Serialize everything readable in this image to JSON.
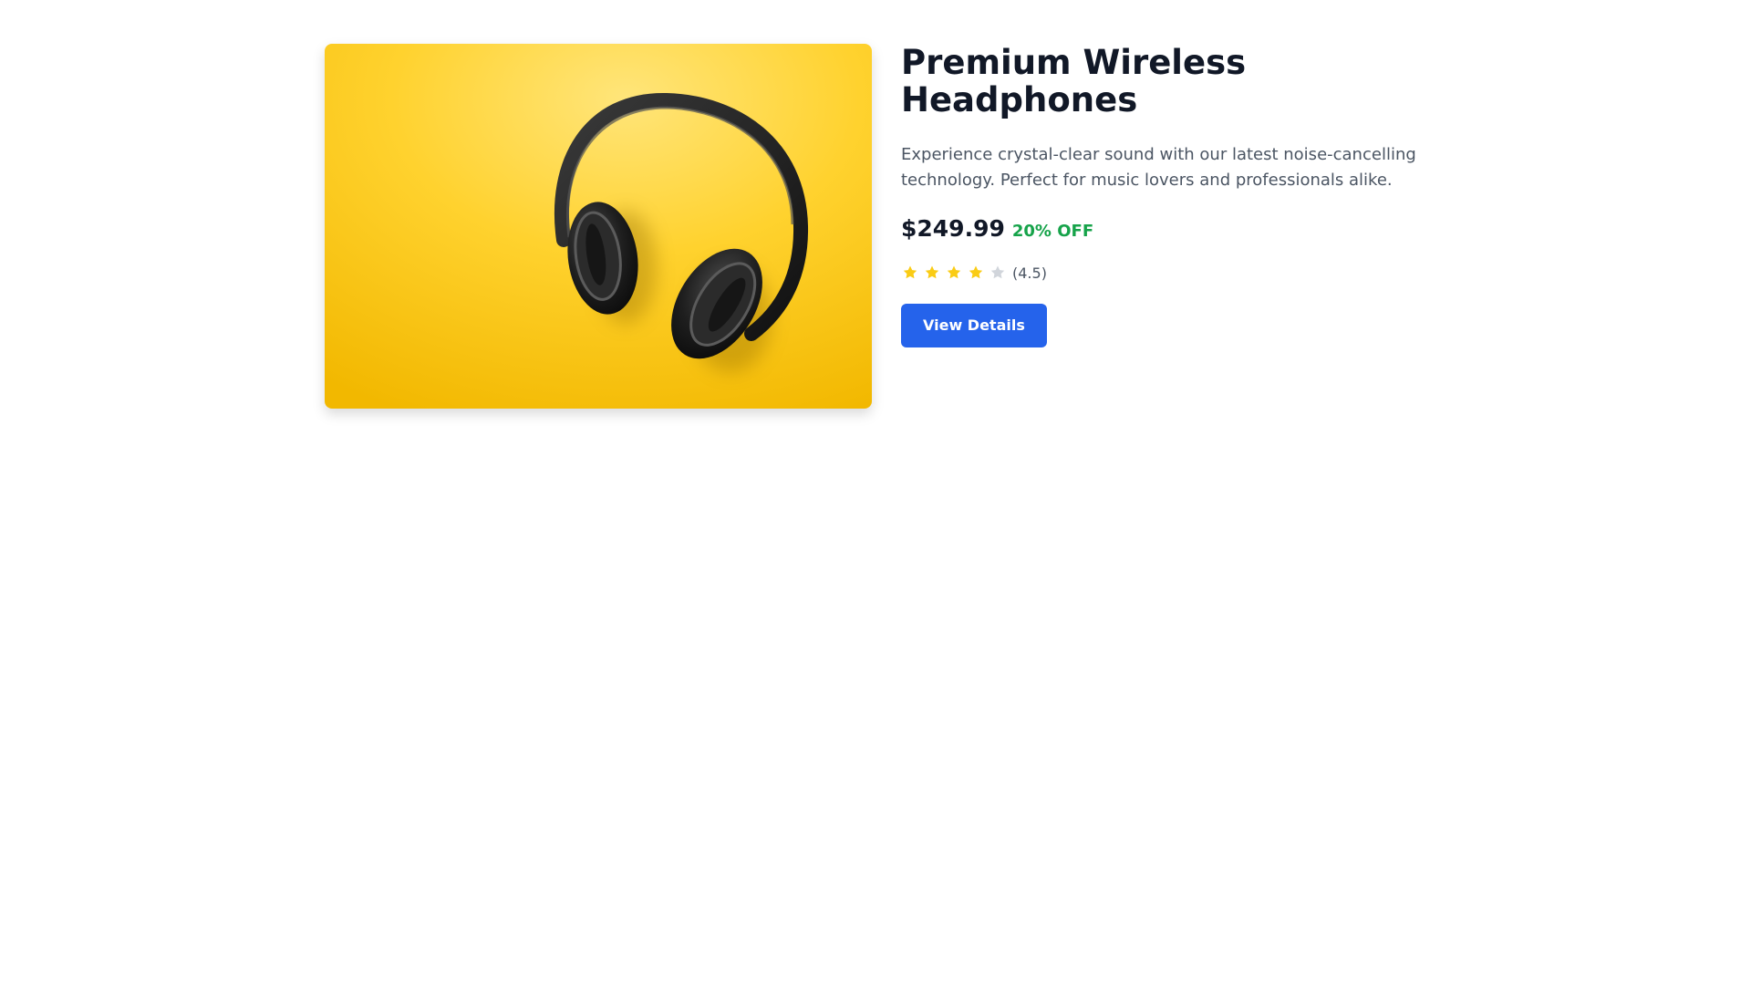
{
  "product": {
    "title": "Premium Wireless Headphones",
    "description": "Experience crystal-clear sound with our latest noise-cancelling technology. Perfect for music lovers and professionals alike.",
    "price": "$249.99",
    "discount": "20% OFF",
    "rating_text": "(4.5)",
    "stars": [
      "star-filled",
      "star-filled",
      "star-filled",
      "star-filled",
      "star-empty"
    ],
    "cta_label": "View Details",
    "image_subject": "headphones-on-yellow"
  },
  "colors": {
    "accent": "#2563eb",
    "discount": "#16a34a",
    "star_filled": "#facc15",
    "star_empty": "#d1d5db",
    "image_background": "#fdc800"
  }
}
